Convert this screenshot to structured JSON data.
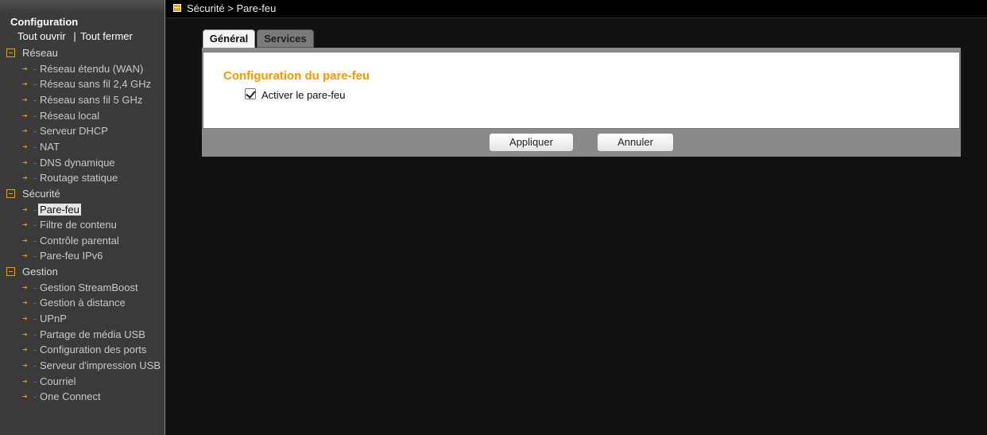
{
  "sidebar": {
    "title": "Configuration",
    "open_all": "Tout ouvrir",
    "separator": "|",
    "close_all": "Tout fermer",
    "groups": [
      {
        "label": "Réseau",
        "items": [
          "Réseau étendu (WAN)",
          "Réseau sans fil 2,4 GHz",
          "Réseau sans fil 5 GHz",
          "Réseau local",
          "Serveur DHCP",
          "NAT",
          "DNS dynamique",
          "Routage statique"
        ]
      },
      {
        "label": "Sécurité",
        "items": [
          "Pare-feu",
          "Filtre de contenu",
          "Contrôle parental",
          "Pare-feu IPv6"
        ]
      },
      {
        "label": "Gestion",
        "items": [
          "Gestion StreamBoost",
          "Gestion à distance",
          "UPnP",
          "Partage de média USB",
          "Configuration des ports",
          "Serveur d'impression USB",
          "Courriel",
          "One Connect"
        ]
      }
    ],
    "selected_item": "Pare-feu"
  },
  "breadcrumb": "Sécurité > Pare-feu",
  "tabs": [
    {
      "label": "Général",
      "active": true
    },
    {
      "label": "Services",
      "active": false
    }
  ],
  "panel": {
    "title": "Configuration du pare-feu",
    "checkbox_label": "Activer le pare-feu",
    "checkbox_checked": true
  },
  "buttons": {
    "apply": "Appliquer",
    "cancel": "Annuler"
  },
  "colors": {
    "accent": "#f29a00",
    "background": "#121212",
    "sidebar": "#3a3a3a"
  }
}
